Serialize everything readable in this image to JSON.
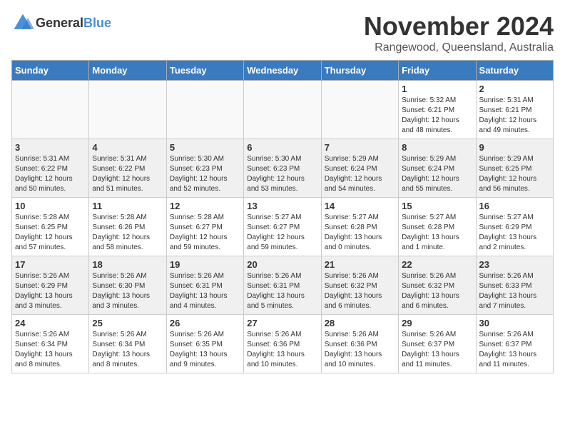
{
  "header": {
    "logo_general": "General",
    "logo_blue": "Blue",
    "month": "November 2024",
    "location": "Rangewood, Queensland, Australia"
  },
  "weekdays": [
    "Sunday",
    "Monday",
    "Tuesday",
    "Wednesday",
    "Thursday",
    "Friday",
    "Saturday"
  ],
  "weeks": [
    [
      {
        "day": "",
        "info": ""
      },
      {
        "day": "",
        "info": ""
      },
      {
        "day": "",
        "info": ""
      },
      {
        "day": "",
        "info": ""
      },
      {
        "day": "",
        "info": ""
      },
      {
        "day": "1",
        "info": "Sunrise: 5:32 AM\nSunset: 6:21 PM\nDaylight: 12 hours\nand 48 minutes."
      },
      {
        "day": "2",
        "info": "Sunrise: 5:31 AM\nSunset: 6:21 PM\nDaylight: 12 hours\nand 49 minutes."
      }
    ],
    [
      {
        "day": "3",
        "info": "Sunrise: 5:31 AM\nSunset: 6:22 PM\nDaylight: 12 hours\nand 50 minutes."
      },
      {
        "day": "4",
        "info": "Sunrise: 5:31 AM\nSunset: 6:22 PM\nDaylight: 12 hours\nand 51 minutes."
      },
      {
        "day": "5",
        "info": "Sunrise: 5:30 AM\nSunset: 6:23 PM\nDaylight: 12 hours\nand 52 minutes."
      },
      {
        "day": "6",
        "info": "Sunrise: 5:30 AM\nSunset: 6:23 PM\nDaylight: 12 hours\nand 53 minutes."
      },
      {
        "day": "7",
        "info": "Sunrise: 5:29 AM\nSunset: 6:24 PM\nDaylight: 12 hours\nand 54 minutes."
      },
      {
        "day": "8",
        "info": "Sunrise: 5:29 AM\nSunset: 6:24 PM\nDaylight: 12 hours\nand 55 minutes."
      },
      {
        "day": "9",
        "info": "Sunrise: 5:29 AM\nSunset: 6:25 PM\nDaylight: 12 hours\nand 56 minutes."
      }
    ],
    [
      {
        "day": "10",
        "info": "Sunrise: 5:28 AM\nSunset: 6:25 PM\nDaylight: 12 hours\nand 57 minutes."
      },
      {
        "day": "11",
        "info": "Sunrise: 5:28 AM\nSunset: 6:26 PM\nDaylight: 12 hours\nand 58 minutes."
      },
      {
        "day": "12",
        "info": "Sunrise: 5:28 AM\nSunset: 6:27 PM\nDaylight: 12 hours\nand 59 minutes."
      },
      {
        "day": "13",
        "info": "Sunrise: 5:27 AM\nSunset: 6:27 PM\nDaylight: 12 hours\nand 59 minutes."
      },
      {
        "day": "14",
        "info": "Sunrise: 5:27 AM\nSunset: 6:28 PM\nDaylight: 13 hours\nand 0 minutes."
      },
      {
        "day": "15",
        "info": "Sunrise: 5:27 AM\nSunset: 6:28 PM\nDaylight: 13 hours\nand 1 minute."
      },
      {
        "day": "16",
        "info": "Sunrise: 5:27 AM\nSunset: 6:29 PM\nDaylight: 13 hours\nand 2 minutes."
      }
    ],
    [
      {
        "day": "17",
        "info": "Sunrise: 5:26 AM\nSunset: 6:29 PM\nDaylight: 13 hours\nand 3 minutes."
      },
      {
        "day": "18",
        "info": "Sunrise: 5:26 AM\nSunset: 6:30 PM\nDaylight: 13 hours\nand 3 minutes."
      },
      {
        "day": "19",
        "info": "Sunrise: 5:26 AM\nSunset: 6:31 PM\nDaylight: 13 hours\nand 4 minutes."
      },
      {
        "day": "20",
        "info": "Sunrise: 5:26 AM\nSunset: 6:31 PM\nDaylight: 13 hours\nand 5 minutes."
      },
      {
        "day": "21",
        "info": "Sunrise: 5:26 AM\nSunset: 6:32 PM\nDaylight: 13 hours\nand 6 minutes."
      },
      {
        "day": "22",
        "info": "Sunrise: 5:26 AM\nSunset: 6:32 PM\nDaylight: 13 hours\nand 6 minutes."
      },
      {
        "day": "23",
        "info": "Sunrise: 5:26 AM\nSunset: 6:33 PM\nDaylight: 13 hours\nand 7 minutes."
      }
    ],
    [
      {
        "day": "24",
        "info": "Sunrise: 5:26 AM\nSunset: 6:34 PM\nDaylight: 13 hours\nand 8 minutes."
      },
      {
        "day": "25",
        "info": "Sunrise: 5:26 AM\nSunset: 6:34 PM\nDaylight: 13 hours\nand 8 minutes."
      },
      {
        "day": "26",
        "info": "Sunrise: 5:26 AM\nSunset: 6:35 PM\nDaylight: 13 hours\nand 9 minutes."
      },
      {
        "day": "27",
        "info": "Sunrise: 5:26 AM\nSunset: 6:36 PM\nDaylight: 13 hours\nand 10 minutes."
      },
      {
        "day": "28",
        "info": "Sunrise: 5:26 AM\nSunset: 6:36 PM\nDaylight: 13 hours\nand 10 minutes."
      },
      {
        "day": "29",
        "info": "Sunrise: 5:26 AM\nSunset: 6:37 PM\nDaylight: 13 hours\nand 11 minutes."
      },
      {
        "day": "30",
        "info": "Sunrise: 5:26 AM\nSunset: 6:37 PM\nDaylight: 13 hours\nand 11 minutes."
      }
    ]
  ]
}
